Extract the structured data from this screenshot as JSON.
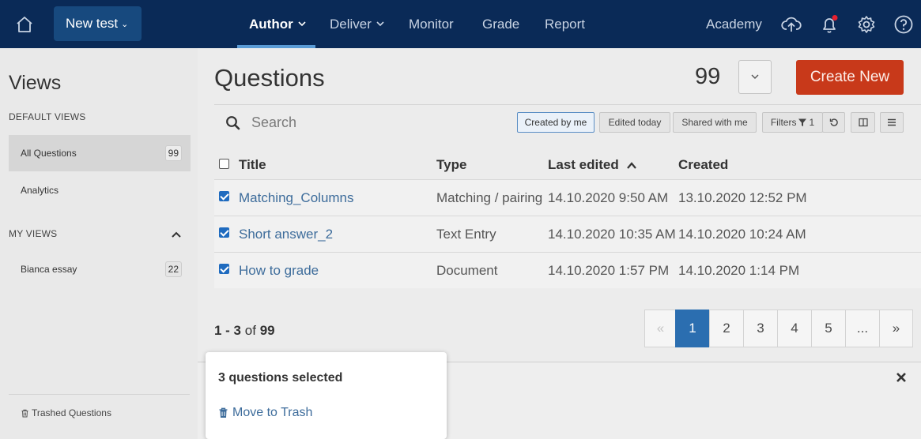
{
  "topbar": {
    "new_test_label": "New test",
    "nav": [
      {
        "label": "Author",
        "has_dropdown": true,
        "active": true
      },
      {
        "label": "Deliver",
        "has_dropdown": true,
        "active": false
      },
      {
        "label": "Monitor",
        "has_dropdown": false,
        "active": false
      },
      {
        "label": "Grade",
        "has_dropdown": false,
        "active": false
      },
      {
        "label": "Report",
        "has_dropdown": false,
        "active": false
      }
    ],
    "academy_label": "Academy",
    "icons": [
      "home-icon",
      "upload-icon",
      "bell-icon",
      "gear-icon",
      "help-icon"
    ],
    "notification_dot_color": "#e8202f"
  },
  "sidebar": {
    "title": "Views",
    "default_views_heading": "DEFAULT VIEWS",
    "default_views": [
      {
        "label": "All Questions",
        "count": "99",
        "active": true
      },
      {
        "label": "Analytics",
        "count": "",
        "active": false
      }
    ],
    "my_views_heading": "MY VIEWS",
    "my_views": [
      {
        "label": "Bianca essay",
        "count": "22"
      }
    ],
    "trash_label": "Trashed Questions"
  },
  "main": {
    "title": "Questions",
    "total_count": "99",
    "create_button": "Create New",
    "search_placeholder": "Search",
    "filter_chips": [
      {
        "label": "Created by me",
        "active": true
      },
      {
        "label": "Edited today",
        "active": false
      },
      {
        "label": "Shared with me",
        "active": false
      }
    ],
    "filters_label": "Filters",
    "filters_count": "1",
    "columns": [
      "Title",
      "Type",
      "Last edited",
      "Created"
    ],
    "sorted_column": "Last edited",
    "rows": [
      {
        "title": "Matching_Columns",
        "type": "Matching / pairing",
        "last_edited": "14.10.2020 9:50 AM",
        "created": "13.10.2020 12:52 PM",
        "checked": true
      },
      {
        "title": "Short answer_2",
        "type": "Text Entry",
        "last_edited": "14.10.2020 10:35 AM",
        "created": "14.10.2020 10:24 AM",
        "checked": true
      },
      {
        "title": "How to grade",
        "type": "Document",
        "last_edited": "14.10.2020 1:57 PM",
        "created": "14.10.2020 1:14 PM",
        "checked": true
      }
    ],
    "range_text": "1 - 3",
    "range_of": "of",
    "range_total": "99",
    "pagination": [
      "«",
      "1",
      "2",
      "3",
      "4",
      "5",
      "...",
      "»"
    ],
    "current_page": "1"
  },
  "selection": {
    "count_text": "3 questions selected",
    "move_to_trash": "Move to Trash"
  },
  "colors": {
    "topbar": "#0a2a57",
    "accent": "#2b6eb0",
    "create_button": "#c8391a",
    "link": "#3d6c9b"
  }
}
